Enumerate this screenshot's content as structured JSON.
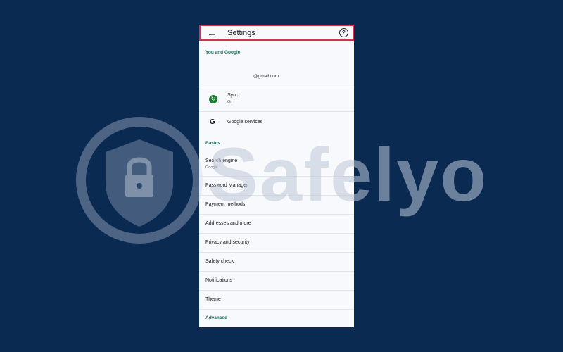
{
  "watermark": {
    "text": "Safelyo"
  },
  "header": {
    "title": "Settings",
    "back_icon": "arrow-left-icon",
    "help_icon": "help-circle-icon"
  },
  "sections": {
    "you_and_google": "You and Google",
    "basics": "Basics",
    "advanced": "Advanced"
  },
  "account": {
    "email": "@gmail.com"
  },
  "sync": {
    "label": "Sync",
    "status": "On"
  },
  "google_services": {
    "label": "Google services"
  },
  "search_engine": {
    "label": "Search engine",
    "value": "Google"
  },
  "items": [
    "Password Manager",
    "Payment methods",
    "Addresses and more",
    "Privacy and security",
    "Safety check",
    "Notifications",
    "Theme"
  ],
  "colors": {
    "background": "#0b2a52",
    "highlight": "#d9304c",
    "section": "#1a6b63",
    "sync_green": "#1e7d32"
  }
}
